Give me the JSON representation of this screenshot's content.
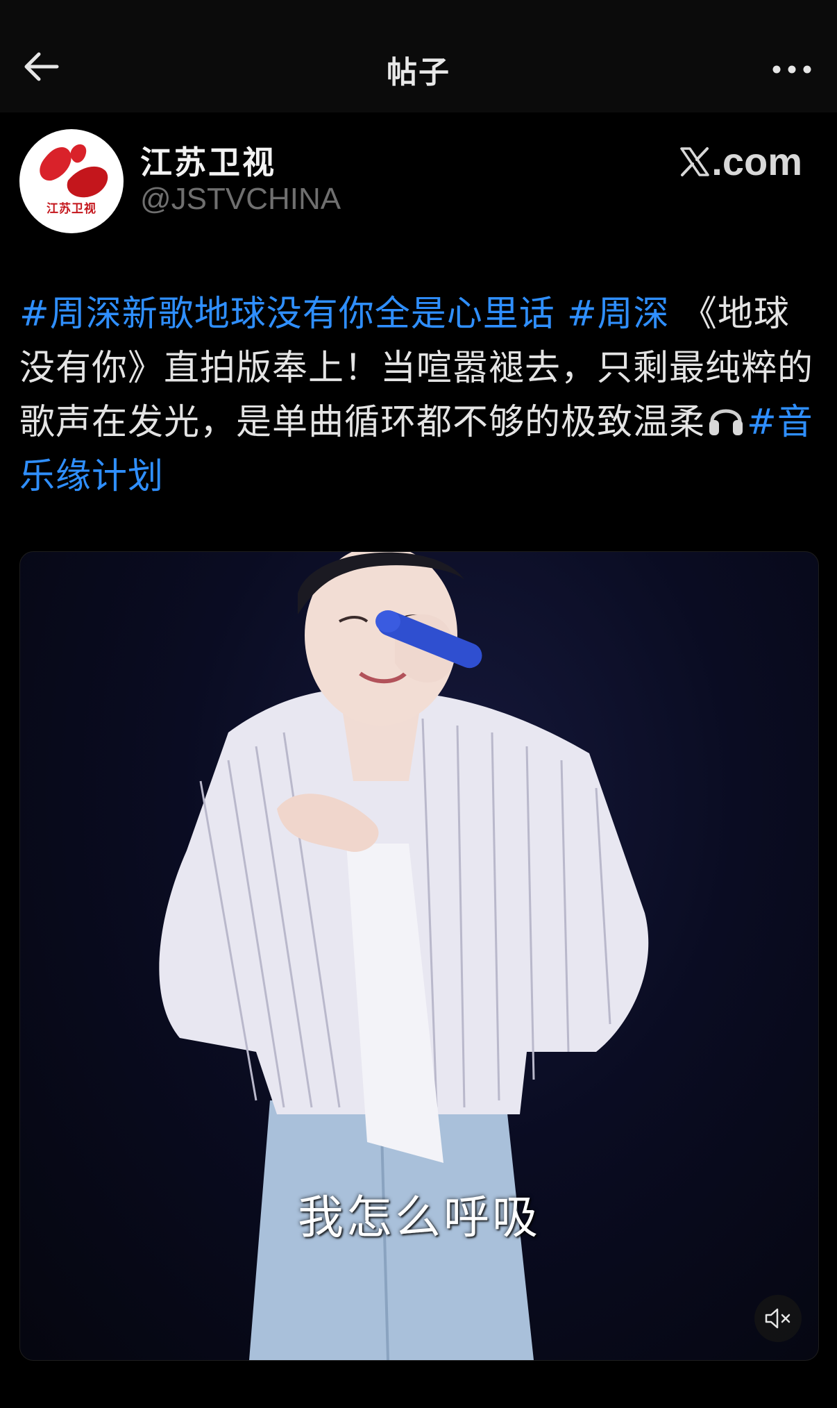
{
  "header": {
    "title": "帖子"
  },
  "author": {
    "name": "江苏卫视",
    "handle": "@JSTVCHINA",
    "avatar_caption": "江苏卫视"
  },
  "source": {
    "label": ".com"
  },
  "post": {
    "tag1": "#周深新歌地球没有你全是心里话",
    "tag2": "#周深",
    "text": " 《地球没有你》直拍版奉上！当喧嚣褪去，只剩最纯粹的歌声在发光，是单曲循环都不够的极致温柔",
    "tag3": "#音乐缘计划"
  },
  "video": {
    "subtitle": "我怎么呼吸"
  },
  "colors": {
    "hashtag": "#2f8fff",
    "background": "#000000"
  },
  "icons": {
    "back": "arrow-left-icon",
    "more": "ellipsis-icon",
    "x_logo": "x-logo-icon",
    "headphones": "headphones-emoji",
    "mute": "speaker-muted-icon"
  }
}
